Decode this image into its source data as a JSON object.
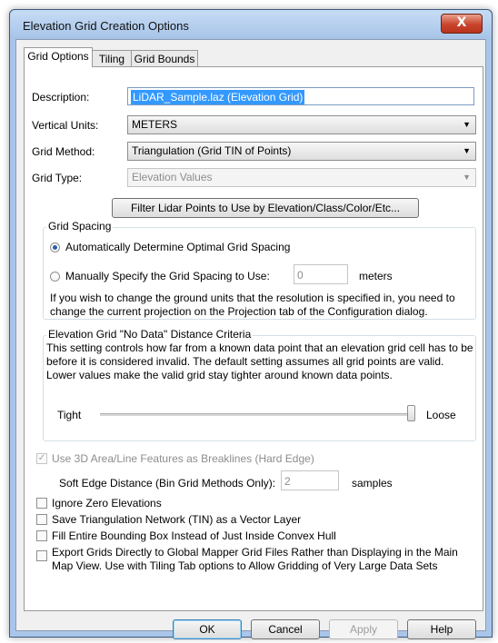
{
  "window": {
    "title": "Elevation Grid Creation Options",
    "close_symbol": "X"
  },
  "tabs": [
    {
      "label": "Grid Options"
    },
    {
      "label": "Tiling"
    },
    {
      "label": "Grid Bounds"
    }
  ],
  "form": {
    "description_label": "Description:",
    "description_value": "LiDAR_Sample.laz (Elevation Grid)",
    "vertical_units_label": "Vertical Units:",
    "vertical_units_value": "METERS",
    "grid_method_label": "Grid Method:",
    "grid_method_value": "Triangulation (Grid TIN of Points)",
    "grid_type_label": "Grid Type:",
    "grid_type_value": "Elevation Values",
    "filter_button": "Filter Lidar Points to Use by Elevation/Class/Color/Etc..."
  },
  "grid_spacing": {
    "title": "Grid Spacing",
    "auto_label": "Automatically Determine Optimal Grid Spacing",
    "manual_label": "Manually Specify the Grid Spacing to Use:",
    "manual_value": "0",
    "units": "meters",
    "note": "If you wish to change the ground units that the resolution is specified in, you need to change the current projection on the Projection tab of the Configuration dialog."
  },
  "no_data": {
    "title": "Elevation Grid \"No Data\" Distance Criteria",
    "description": "This setting controls how far from a known data point that an elevation grid cell has to be before it is considered invalid. The default setting assumes all grid points are valid. Lower values make the valid grid stay tighter around known data points.",
    "tight_label": "Tight",
    "loose_label": "Loose",
    "slider_fraction": 1.0
  },
  "options": {
    "breaklines_label": "Use 3D Area/Line Features as Breaklines (Hard Edge)",
    "soft_edge_label": "Soft Edge Distance (Bin Grid Methods Only):",
    "soft_edge_value": "2",
    "soft_edge_units": "samples",
    "ignore_zero_label": "Ignore Zero Elevations",
    "save_tin_label": "Save Triangulation Network (TIN) as a Vector Layer",
    "fill_bbox_label": "Fill Entire Bounding Box Instead of Just Inside Convex Hull",
    "export_label_line1": "Export Grids Directly to Global Mapper Grid Files Rather than Displaying in the Main",
    "export_label_line2": "Map View. Use with Tiling Tab options to Allow Gridding of Very Large Data Sets"
  },
  "buttons": {
    "ok": "OK",
    "cancel": "Cancel",
    "apply": "Apply",
    "help": "Help"
  },
  "icons": {
    "radio_selected": "radio-selected",
    "checkbox_checked": "check-icon",
    "dropdown": "chevron-down-icon"
  },
  "colors": {
    "title_bar": "#b9d1ee",
    "selection": "#3399ff",
    "close": "#c9442c"
  }
}
